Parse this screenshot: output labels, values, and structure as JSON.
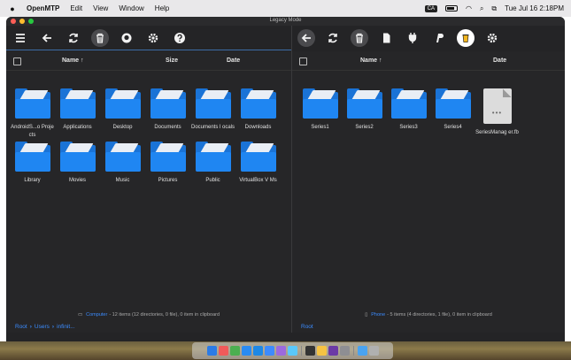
{
  "menubar": {
    "app": "OpenMTP",
    "items": [
      "Edit",
      "View",
      "Window",
      "Help"
    ],
    "badge": "CA",
    "clock": "Tue Jul 16  2:18PM"
  },
  "window": {
    "title": "Legacy Mode"
  },
  "left": {
    "headers": {
      "name": "Name ↑",
      "size": "Size",
      "date": "Date"
    },
    "folders": [
      "AndroidS...o Projects",
      "Applications",
      "Desktop",
      "Documents",
      "Documents l ocals",
      "Downloads",
      "Library",
      "Movies",
      "Music",
      "Pictures",
      "Public",
      "VirtualBox V Ms"
    ],
    "status": {
      "device": "Computer",
      "text": "- 12 items (12 directories, 0 file), 0 item in clipboard"
    },
    "breadcrumb": [
      "Root",
      "Users",
      "infinit..."
    ]
  },
  "right": {
    "headers": {
      "name": "Name ↑",
      "date": "Date"
    },
    "folders": [
      "Series1",
      "Series2",
      "Series3",
      "Series4"
    ],
    "files": [
      "SeriesManag er.fb"
    ],
    "status": {
      "device": "Phone",
      "text": "- 5 items (4 directories, 1 file), 0 item in clipboard"
    },
    "breadcrumb": [
      "Root"
    ]
  },
  "colors": {
    "accent": "#3b8cff",
    "folder": "#1f86f2",
    "background": "#242426"
  },
  "dock": {
    "icons": [
      "finder",
      "calendar",
      "chrome",
      "mail",
      "vscode",
      "safari",
      "app1",
      "app2",
      "terminal",
      "notes",
      "slack",
      "settings",
      "files",
      "trash"
    ]
  }
}
